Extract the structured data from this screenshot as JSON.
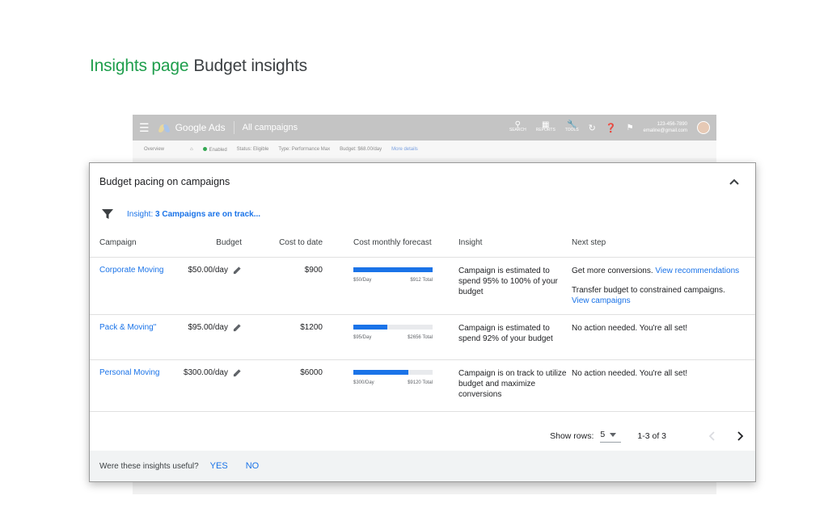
{
  "slide": {
    "title_accent": "Insights page",
    "title_main": "Budget insights"
  },
  "bg_app": {
    "logo": "Google Ads",
    "breadcrumb": "All campaigns",
    "tools": [
      "SEARCH",
      "REPORTS",
      "TOOLS"
    ],
    "account_id": "123-456-7890",
    "account_email": "emaline@gmail.com",
    "filter_bar": {
      "overview": "Overview",
      "enabled": "Enabled",
      "status": "Status: Eligible",
      "type": "Type: Performance Max",
      "budget": "Budget: $68.00/day",
      "more": "More details"
    }
  },
  "card": {
    "title": "Budget pacing on campaigns",
    "insight_prefix": "Insight: ",
    "insight_bold": "3 Campaigns are on track...",
    "columns": {
      "campaign": "Campaign",
      "budget": "Budget",
      "cost": "Cost to date",
      "forecast": "Cost monthly forecast",
      "insight": "Insight",
      "next": "Next step"
    },
    "rows": [
      {
        "campaign": "Corporate Moving",
        "budget": "$50.00/day",
        "cost": "$900",
        "forecast_fill": 1.0,
        "forecast_left": "$50/Day",
        "forecast_right": "$912 Total",
        "insight": "Campaign is estimated to spend 95% to 100% of your budget",
        "next_text": "Get more conversions. ",
        "next_link": "View recommendations",
        "next_text2": "Transfer budget to constrained campaigns.",
        "next_link2": "View campaigns"
      },
      {
        "campaign": "Pack & Moving\"",
        "budget": "$95.00/day",
        "cost": "$1200",
        "forecast_fill": 0.43,
        "forecast_left": "$95/Day",
        "forecast_right": "$2656 Total",
        "insight": "Campaign is estimated to spend 92% of your budget",
        "next_text": "No action needed. You're all set!"
      },
      {
        "campaign": "Personal Moving",
        "budget": "$300.00/day",
        "cost": "$6000",
        "forecast_fill": 0.69,
        "forecast_left": "$300/Day",
        "forecast_right": "$9120 Total",
        "insight": "Campaign is on track to utilize budget and maximize conversions",
        "next_text": "No action needed. You're all set!"
      }
    ],
    "pager": {
      "show_rows_label": "Show rows:",
      "rows_value": "5",
      "range": "1-3 of 3"
    },
    "footer": {
      "question": "Were these insights useful?",
      "yes": "YES",
      "no": "NO"
    }
  },
  "colors": {
    "accent_green": "#1e9e4c",
    "link_blue": "#1a73e8",
    "bar_track": "#e8eaed"
  }
}
